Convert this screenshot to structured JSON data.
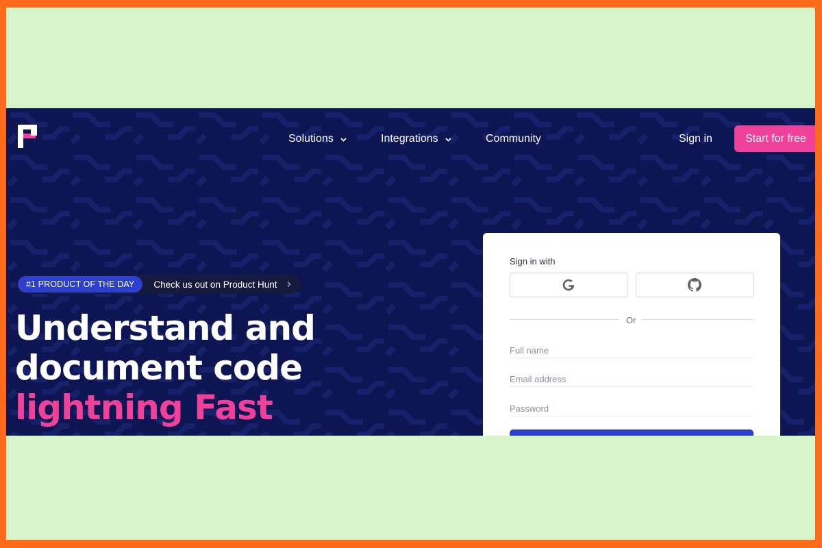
{
  "nav": {
    "items": [
      {
        "label": "Solutions",
        "has_dropdown": true
      },
      {
        "label": "Integrations",
        "has_dropdown": true
      },
      {
        "label": "Community",
        "has_dropdown": false
      }
    ],
    "sign_in": "Sign in",
    "start_free": "Start for free"
  },
  "badge": {
    "pill": "#1 PRODUCT OF THE DAY",
    "text": "Check us out on Product Hunt",
    "arrow_icon": "chevron-right-icon"
  },
  "hero": {
    "line1": "Understand and",
    "line2": "document code",
    "line3": "lightning Fast"
  },
  "form": {
    "title": "Sign in with",
    "providers": [
      {
        "name": "google",
        "icon": "google-icon"
      },
      {
        "name": "github",
        "icon": "github-icon"
      }
    ],
    "divider": "Or",
    "full_name_placeholder": "Full name",
    "email_placeholder": "Email address",
    "password_placeholder": "Password"
  },
  "colors": {
    "background_navy": "#0d1552",
    "accent_pink": "#f0419a",
    "primary_blue": "#2c3fcf",
    "frame_orange": "#ff6a1a",
    "frame_green": "#d6f5c8"
  }
}
